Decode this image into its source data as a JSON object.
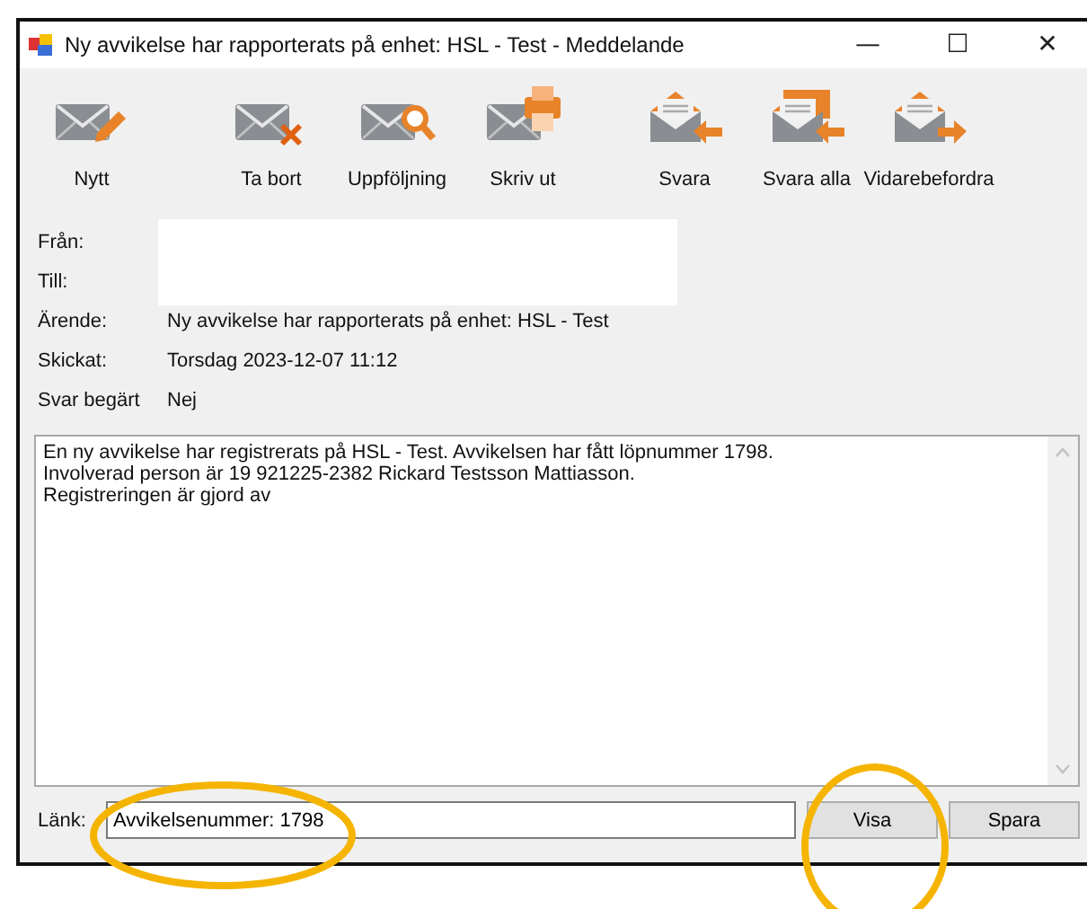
{
  "window": {
    "title": "Ny avvikelse har rapporterats på enhet: HSL - Test - Meddelande",
    "controls": [
      "—",
      "☐",
      "✕"
    ]
  },
  "toolbar": [
    [
      {
        "label": "Nytt",
        "kind": "new"
      }
    ],
    [
      {
        "label": "Ta bort",
        "kind": "delete"
      },
      {
        "label": "Uppföljning",
        "kind": "followup"
      },
      {
        "label": "Skriv ut",
        "kind": "print"
      }
    ],
    [
      {
        "label": "Svara",
        "kind": "reply"
      },
      {
        "label": "Svara alla",
        "kind": "replyall"
      },
      {
        "label": "Vidarebefordra",
        "kind": "forward"
      }
    ]
  ],
  "header_fields": [
    {
      "label": "Från:"
    },
    {
      "label": "Till:"
    },
    {
      "label": "Ärende:",
      "value": "Ny avvikelse har rapporterats på enhet: HSL - Test"
    },
    {
      "label": "Skickat:",
      "value": "Torsdag 2023-12-07 11:12"
    },
    {
      "label": "Svar begärt",
      "value": "Nej"
    }
  ],
  "message_lines": [
    "En ny avvikelse har registrerats på HSL - Test. Avvikelsen har fått löpnummer 1798.",
    "Involverad person är 19 921225-2382  Rickard Testsson Mattiasson.",
    "Registreringen är gjord av"
  ],
  "link": {
    "label": "Länk:",
    "value": "Avvikelsenummer: 1798"
  },
  "buttons": [
    "Visa",
    "Spara"
  ]
}
